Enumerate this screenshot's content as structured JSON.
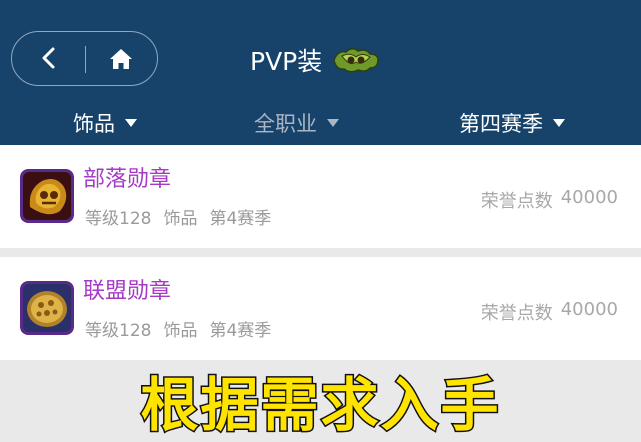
{
  "header": {
    "title": "PVP装",
    "badge_icon": "bg-logo-icon"
  },
  "filters": [
    {
      "label": "饰品",
      "active": true
    },
    {
      "label": "全职业",
      "active": false
    },
    {
      "label": "第四赛季",
      "active": true
    }
  ],
  "items": [
    {
      "name": "部落勋章",
      "icon": "horde-medal-icon",
      "level": "等级128",
      "category": "饰品",
      "season": "第4赛季",
      "price_label": "荣誉点数",
      "price_value": "40000"
    },
    {
      "name": "联盟勋章",
      "icon": "alliance-medal-icon",
      "level": "等级128",
      "category": "饰品",
      "season": "第4赛季",
      "price_label": "荣誉点数",
      "price_value": "40000"
    }
  ],
  "caption": "根据需求入手",
  "colors": {
    "header_bg": "#17436a",
    "item_name": "#a53ac6",
    "caption": "#ffe400"
  }
}
